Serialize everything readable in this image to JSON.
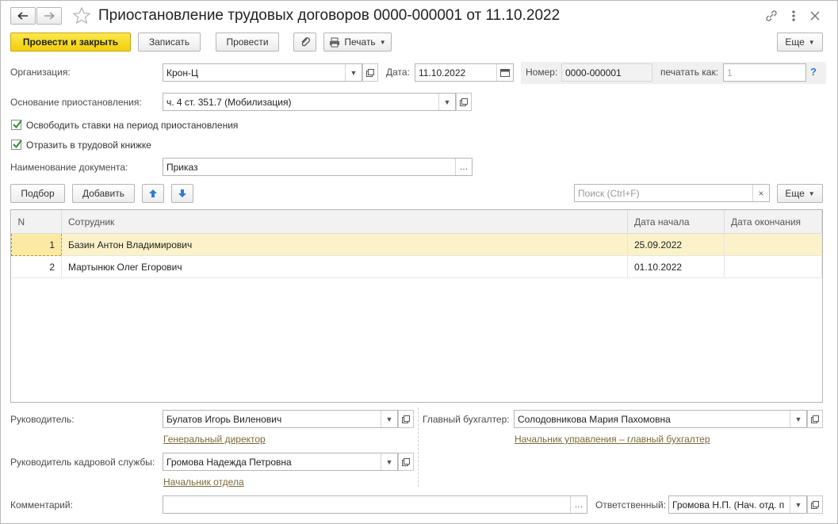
{
  "title": "Приостановление трудовых договоров 0000-000001 от 11.10.2022",
  "toolbar": {
    "post_close": "Провести и закрыть",
    "save": "Записать",
    "post": "Провести",
    "print": "Печать",
    "more": "Еще"
  },
  "organization": {
    "label": "Организация:",
    "value": "Крон-Ц"
  },
  "date": {
    "label": "Дата:",
    "value": "11.10.2022"
  },
  "number": {
    "label": "Номер:",
    "value": "0000-000001"
  },
  "print_as": {
    "label": "печатать как:",
    "placeholder": "1"
  },
  "help": "?",
  "basis": {
    "label": "Основание приостановления:",
    "value": "ч. 4 ст. 351.7 (Мобилизация)"
  },
  "checkboxes": {
    "free_rates": {
      "label": "Освободить ставки на период приостановления",
      "checked": true
    },
    "workbook": {
      "label": "Отразить в трудовой книжке",
      "checked": true
    }
  },
  "doc_name": {
    "label": "Наименование документа:",
    "value": "Приказ"
  },
  "table_toolbar": {
    "pick": "Подбор",
    "add": "Добавить",
    "search_placeholder": "Поиск (Ctrl+F)",
    "more": "Еще"
  },
  "table": {
    "columns": [
      "N",
      "Сотрудник",
      "Дата начала",
      "Дата окончания"
    ],
    "rows": [
      {
        "n": "1",
        "employee": "Базин Антон Владимирович",
        "start": "25.09.2022",
        "end": ""
      },
      {
        "n": "2",
        "employee": "Мартынюк Олег Егорович",
        "start": "01.10.2022",
        "end": ""
      }
    ]
  },
  "head": {
    "label": "Руководитель:",
    "value": "Булатов Игорь Виленович",
    "position": "Генеральный директор"
  },
  "chief_accountant": {
    "label": "Главный бухгалтер:",
    "value": "Солодовникова Мария Пахомовна",
    "position": "Начальник управления – главный бухгалтер"
  },
  "hr_head": {
    "label": "Руководитель кадровой службы:",
    "value": "Громова Надежда Петровна",
    "position": "Начальник отдела"
  },
  "comment": {
    "label": "Комментарий:",
    "value": ""
  },
  "responsible": {
    "label": "Ответственный:",
    "value": "Громова Н.П. (Нач. отд. п"
  },
  "colors": {
    "primary": "#f5d40f",
    "accent_link": "#7a6a3a",
    "selection": "#fcf2c9"
  }
}
